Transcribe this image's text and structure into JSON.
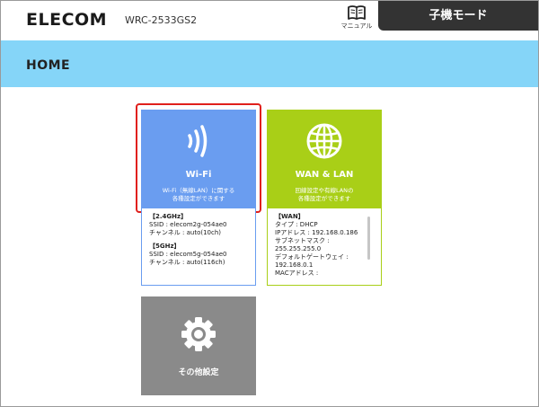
{
  "header": {
    "logo": "ELECOM",
    "model": "WRC-2533GS2",
    "manual_label": "マニュアル",
    "mode_button": "子機モード"
  },
  "page": {
    "title": "HOME"
  },
  "tiles": {
    "wifi": {
      "title": "Wi-Fi",
      "desc1": "Wi-Fi（無線LAN）に関する",
      "desc2": "各種設定ができます",
      "color": "#6a9df0"
    },
    "wan": {
      "title": "WAN & LAN",
      "desc1": "回線設定や有線LANの",
      "desc2": "各種設定ができます",
      "color": "#a9cf17"
    },
    "other": {
      "title": "その他設定",
      "color": "#8a8a8a"
    }
  },
  "wifi_info": {
    "band24_header": "【2.4GHz】",
    "band24_ssid": "SSID : elecom2g-054ae0",
    "band24_channel": "チャンネル : auto(10ch)",
    "band5_header": "【5GHz】",
    "band5_ssid": "SSID : elecom5g-054ae0",
    "band5_channel": "チャンネル : auto(116ch)"
  },
  "wan_info": {
    "header": "【WAN】",
    "type": "タイプ : DHCP",
    "ip": "IPアドレス : 192.168.0.186",
    "subnet_label": "サブネットマスク :",
    "subnet_value": "255.255.255.0",
    "gateway_label": "デフォルトゲートウェイ :",
    "gateway_value": "192.168.0.1",
    "mac_label": "MACアドレス :"
  },
  "colors": {
    "titlebar": "#85d5f8",
    "mode_button": "#333333",
    "selection": "#e0201c"
  }
}
